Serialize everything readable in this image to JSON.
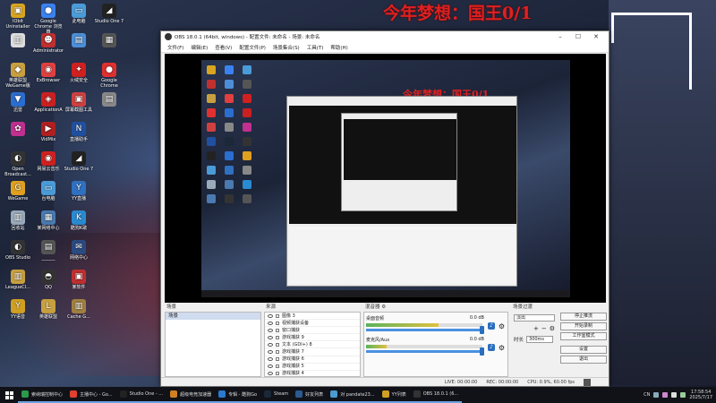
{
  "desktop": {
    "overlay_title": "今年梦想：国王0/1",
    "icons": [
      {
        "label": "IObit Uninstaller",
        "color": "#d9a520",
        "glyph": "▣"
      },
      {
        "label": "Google Chrome 浏览器",
        "color": "#3a82f0",
        "glyph": "●"
      },
      {
        "label": "此电脑",
        "color": "#4a9bd8",
        "glyph": "▭"
      },
      {
        "label": "Studio One 7",
        "color": "#222",
        "glyph": "◢"
      },
      {
        "label": "",
        "color": "#ddd",
        "glyph": "▥"
      },
      {
        "label": "Administrator",
        "color": "#c03030",
        "glyph": "☻"
      },
      {
        "label": "",
        "color": "#4c8fd8",
        "glyph": "▤"
      },
      {
        "label": "",
        "color": "#555",
        "glyph": "▦"
      },
      {
        "label": "英雄联盟WeGame版",
        "color": "#c8a040",
        "glyph": "◆"
      },
      {
        "label": "ExBrowser",
        "color": "#e04040",
        "glyph": "◉"
      },
      {
        "label": "火绒安全",
        "color": "#d02020",
        "glyph": "✦"
      },
      {
        "label": "Google Chrome",
        "color": "#e03030",
        "glyph": "●"
      },
      {
        "label": "迅雷",
        "color": "#2a6ed0",
        "glyph": "▼"
      },
      {
        "label": "ApplicationA",
        "color": "#ca2020",
        "glyph": "◈"
      },
      {
        "label": "屏幕截图工具",
        "color": "#d04040",
        "glyph": "▣"
      },
      {
        "label": "",
        "color": "#888",
        "glyph": "▤"
      },
      {
        "label": "",
        "color": "#c03090",
        "glyph": "✿"
      },
      {
        "label": "VidMix",
        "color": "#b02020",
        "glyph": "▶"
      },
      {
        "label": "直播助手",
        "color": "#2050a0",
        "glyph": "N"
      },
      {
        "label": "Steam",
        "color": "#1b2838",
        "glyph": "◎"
      },
      {
        "label": "Open Broadcast...",
        "color": "#333",
        "glyph": "◐"
      },
      {
        "label": "网易云音乐",
        "color": "#d02020",
        "glyph": "◉"
      },
      {
        "label": "Studio One 7",
        "color": "#222",
        "glyph": "◢"
      },
      {
        "label": "Bandizip",
        "color": "#2a6ed0",
        "glyph": "◆"
      },
      {
        "label": "WeGame",
        "color": "#e0a020",
        "glyph": "G"
      },
      {
        "label": "台电脑",
        "color": "#4a9bd8",
        "glyph": "▭"
      },
      {
        "label": "YY直播",
        "color": "#3070c0",
        "glyph": "Y"
      },
      {
        "label": "GC551_Wi...",
        "color": "#888",
        "glyph": "▤"
      },
      {
        "label": "回收站",
        "color": "#9ab",
        "glyph": "▥"
      },
      {
        "label": "某网络中心",
        "color": "#4a7ab0",
        "glyph": "▦"
      },
      {
        "label": "酷狗K歌",
        "color": "#2a8ad0",
        "glyph": "K"
      },
      {
        "label": "控制面板",
        "color": "#4a7ab0",
        "glyph": "▦"
      },
      {
        "label": "OBS Studio",
        "color": "#333",
        "glyph": "◐"
      },
      {
        "label": "______",
        "color": "#555",
        "glyph": "▤"
      },
      {
        "label": "网络中心",
        "color": "#2a4a80",
        "glyph": "✉"
      },
      {
        "label": "微信",
        "color": "#2aa040",
        "glyph": "◉"
      },
      {
        "label": "LeagueCl...",
        "color": "#c8a040",
        "glyph": "▥"
      },
      {
        "label": "QQ",
        "color": "#333",
        "glyph": "◓"
      },
      {
        "label": "某软件",
        "color": "#c03030",
        "glyph": "▣"
      },
      {
        "label": "BrowserEg...",
        "color": "#666",
        "glyph": "▤"
      },
      {
        "label": "YY语音",
        "color": "#d0a020",
        "glyph": "Y"
      },
      {
        "label": "英雄联盟",
        "color": "#c8a040",
        "glyph": "L"
      },
      {
        "label": "Cache G...",
        "color": "#a08040",
        "glyph": "▥"
      }
    ]
  },
  "obs": {
    "title": "OBS 18.0.1 (64bit, windows) - 配置文件: 未命名 - 场景: 未命名",
    "menu": [
      "文件(F)",
      "编辑(E)",
      "查看(V)",
      "配置文件(P)",
      "场景集合(S)",
      "工具(T)",
      "帮助(H)"
    ],
    "scenes": {
      "title": "场景",
      "items": [
        "场景"
      ]
    },
    "sources": {
      "title": "来源",
      "items": [
        "图像 3",
        "视频捕获设备",
        "窗口捕获",
        "游戏捕获 9",
        "文本 (GDI+) 8",
        "游戏捕获 7",
        "游戏捕获 6",
        "游戏捕获 5",
        "游戏捕获 4",
        "游戏捕获 3"
      ]
    },
    "mixer": {
      "title": "混音器",
      "channels": [
        {
          "name": "桌面音频",
          "db": "0.0 dB",
          "level": 0.62
        },
        {
          "name": "麦克风/Aux",
          "db": "0.0 dB",
          "level": 0.18
        }
      ]
    },
    "transitions": {
      "title": "场景过渡",
      "selected": "淡出",
      "duration_label": "时长",
      "duration": "300ms"
    },
    "controls": [
      "停止推流",
      "开始录制",
      "工作室模式",
      "设置",
      "退出"
    ],
    "status": {
      "live": "LIVE: 00:00:00",
      "rec": "REC: 00:00:00",
      "cpu": "CPU: 0.9%, 60.00 fps"
    }
  },
  "taskbar": {
    "items": [
      {
        "label": "索纳瑞控制中心",
        "color": "#2a9a4a"
      },
      {
        "label": "主播中心 - Go...",
        "color": "#e04030"
      },
      {
        "label": "Studio One - ...",
        "color": "#222"
      },
      {
        "label": "超级电竞加速器",
        "color": "#d08020"
      },
      {
        "label": "专辑 - 酷狗Go",
        "color": "#2a7ad0"
      },
      {
        "label": "Steam",
        "color": "#1b2838"
      },
      {
        "label": "好友列表",
        "color": "#2a5a90"
      },
      {
        "label": "对 pandate23...",
        "color": "#4a9ad0"
      },
      {
        "label": "YY列表",
        "color": "#d0a020"
      },
      {
        "label": "OBS 18.0.1 (6...",
        "color": "#333"
      }
    ],
    "tray_lang": "CN",
    "time": "17:58:54",
    "date": "2025/7/17"
  }
}
